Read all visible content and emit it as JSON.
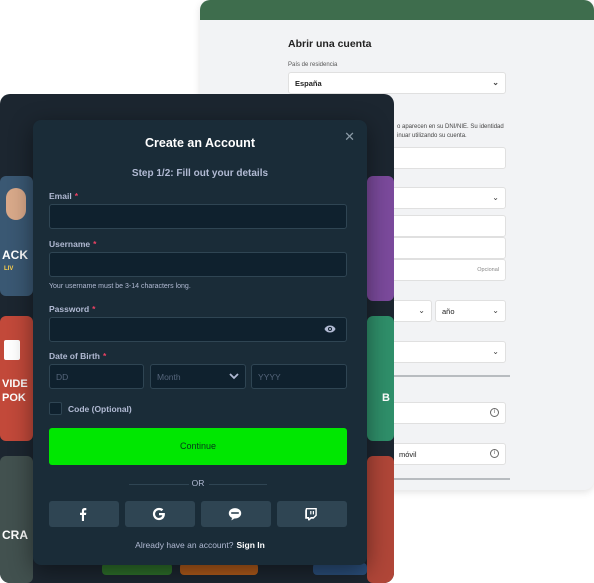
{
  "back_form": {
    "title": "Abrir una cuenta",
    "country_label": "País de residencia",
    "country_value": "España",
    "note_line1": "o aparecen en su DNI/NIE. Su identidad",
    "note_line2": "inuar utilizando su cuenta.",
    "optional_label": "Opcional",
    "year_placeholder": "año",
    "phone_placeholder": "móvil"
  },
  "casino_tiles": {
    "tile_a": "ACK",
    "tile_b": "VIDE",
    "tile_b2": "POK",
    "tile_c": "CRA",
    "tile_d": "B",
    "tile_live": "LIV"
  },
  "modal": {
    "title": "Create an Account",
    "close_icon": "close-icon",
    "step": "Step 1/2: Fill out your details",
    "email": {
      "label": "Email",
      "required": "*",
      "value": ""
    },
    "username": {
      "label": "Username",
      "required": "*",
      "value": "",
      "hint": "Your username must be 3-14 characters long."
    },
    "password": {
      "label": "Password",
      "required": "*",
      "value": ""
    },
    "dob": {
      "label": "Date of Birth",
      "required": "*",
      "day_placeholder": "DD",
      "month_value": "Month",
      "year_placeholder": "YYYY"
    },
    "code_label": "Code (Optional)",
    "continue_label": "Continue",
    "or_label": "OR",
    "social_icons": [
      "facebook-icon",
      "google-icon",
      "line-icon",
      "twitch-icon"
    ],
    "signin_prompt": "Already have an account?",
    "signin_link": "Sign In"
  },
  "colors": {
    "modal_bg": "#1a2c38",
    "input_bg": "#0f212e",
    "accent_green": "#00e701",
    "required_red": "#ed4163",
    "back_header": "#3e6d4d"
  }
}
